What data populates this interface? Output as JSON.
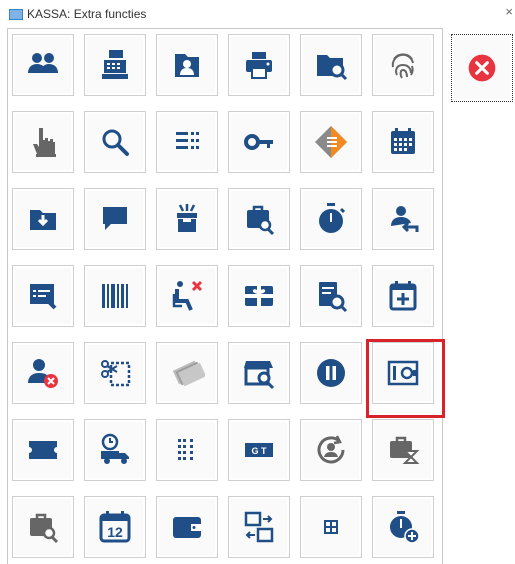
{
  "window": {
    "title": "KASSA: Extra functies",
    "close_glyph": "×"
  },
  "colors": {
    "icon": "#1f4f86",
    "gray": "#666666",
    "accent_orange": "#f28a21",
    "close_red": "#e7343f",
    "highlight": "#d9232a"
  },
  "tiles": [
    {
      "icon": "users-icon"
    },
    {
      "icon": "cash-register-icon"
    },
    {
      "icon": "contact-card-icon"
    },
    {
      "icon": "printer-icon"
    },
    {
      "icon": "folder-search-icon"
    },
    {
      "icon": "fingerprint-icon"
    },
    {
      "icon": "pointer-hand-icon"
    },
    {
      "icon": "search-icon"
    },
    {
      "icon": "list-icon"
    },
    {
      "icon": "key-icon"
    },
    {
      "icon": "diamond-arrows-icon"
    },
    {
      "icon": "calendar-grid-icon"
    },
    {
      "icon": "folder-download-icon"
    },
    {
      "icon": "chat-bubble-icon"
    },
    {
      "icon": "gift-box-icon"
    },
    {
      "icon": "bag-search-icon"
    },
    {
      "icon": "stopwatch-icon"
    },
    {
      "icon": "user-return-icon"
    },
    {
      "icon": "form-edit-icon"
    },
    {
      "icon": "barcode-icon"
    },
    {
      "icon": "seat-cancel-icon"
    },
    {
      "icon": "gift-card-icon"
    },
    {
      "icon": "document-search-icon"
    },
    {
      "icon": "calendar-add-icon"
    },
    {
      "icon": "user-remove-icon"
    },
    {
      "icon": "cut-voucher-icon"
    },
    {
      "icon": "cards-stack-icon"
    },
    {
      "icon": "store-search-icon"
    },
    {
      "icon": "pause-icon"
    },
    {
      "icon": "safe-icon"
    },
    {
      "icon": "ticket-icon"
    },
    {
      "icon": "delivery-truck-clock-icon"
    },
    {
      "icon": "list-dotted-icon"
    },
    {
      "icon": "gt-label-icon"
    },
    {
      "icon": "user-refresh-icon"
    },
    {
      "icon": "bag-hourglass-icon"
    },
    {
      "icon": "bag-search-gray-icon"
    },
    {
      "icon": "calendar-12-icon"
    },
    {
      "icon": "wallet-icon"
    },
    {
      "icon": "transfer-screens-icon"
    },
    {
      "icon": "small-table-icon"
    },
    {
      "icon": "timer-add-icon"
    }
  ],
  "calendar_day": "12",
  "gt_label": "G T",
  "close_button": {
    "icon": "close-circle-icon"
  },
  "selected_tile": "safe-icon"
}
